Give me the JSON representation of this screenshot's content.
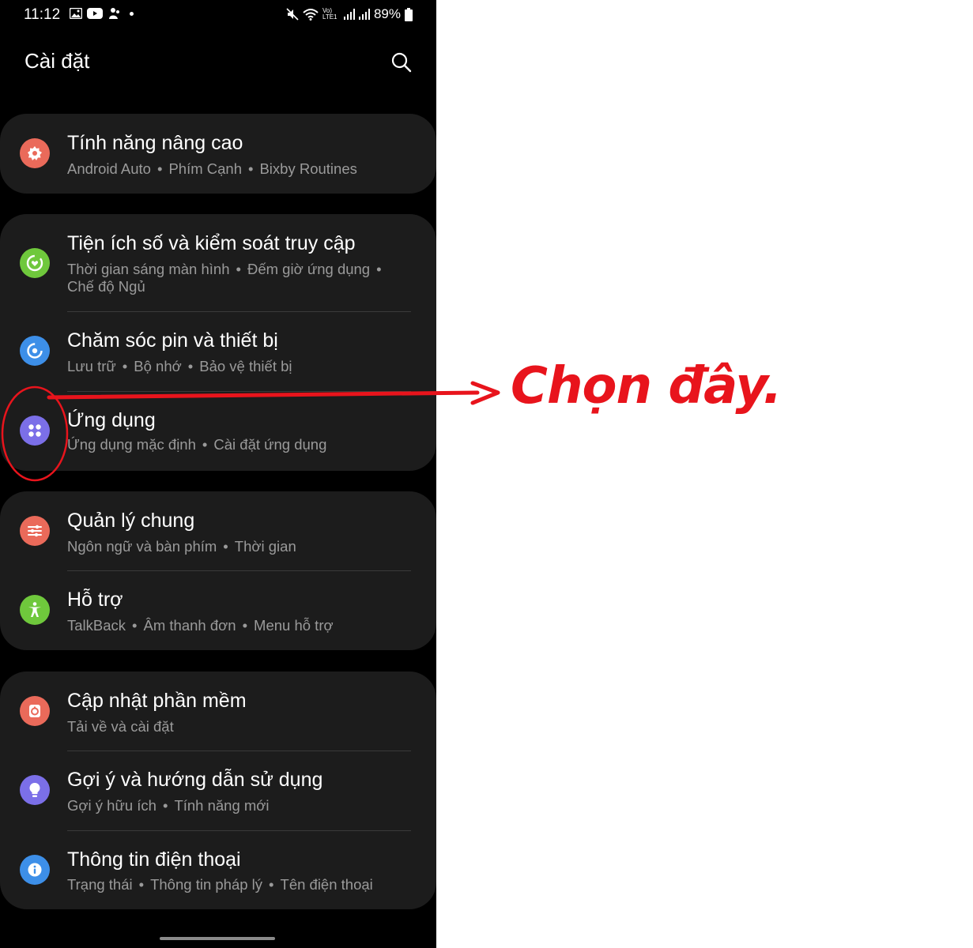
{
  "status_bar": {
    "time": "11:12",
    "network_label": "Vo) LTE1",
    "battery": "89%"
  },
  "app_bar": {
    "title": "Cài đặt",
    "search_icon": "search-icon"
  },
  "groups": [
    {
      "items": [
        {
          "title": "Tính năng nâng cao",
          "subtitle": [
            "Android Auto",
            "Phím Cạnh",
            "Bixby Routines"
          ],
          "icon": "advanced-features-icon",
          "icon_color": "#ea6a5a"
        }
      ]
    },
    {
      "items": [
        {
          "title": "Tiện ích số và kiểm soát truy cập",
          "subtitle": [
            "Thời gian sáng màn hình",
            "Đếm giờ ứng dụng",
            "Chế độ Ngủ"
          ],
          "icon": "digital-wellbeing-icon",
          "icon_color": "#6fc83c"
        },
        {
          "title": "Chăm sóc pin và thiết bị",
          "subtitle": [
            "Lưu trữ",
            "Bộ nhớ",
            "Bảo vệ thiết bị"
          ],
          "icon": "device-care-icon",
          "icon_color": "#3d8fe8"
        },
        {
          "title": "Ứng dụng",
          "subtitle": [
            "Ứng dụng mặc định",
            "Cài đặt ứng dụng"
          ],
          "icon": "apps-icon",
          "icon_color": "#7b6fe8"
        }
      ]
    },
    {
      "items": [
        {
          "title": "Quản lý chung",
          "subtitle": [
            "Ngôn ngữ và bàn phím",
            "Thời gian"
          ],
          "icon": "general-management-icon",
          "icon_color": "#ea6a5a"
        },
        {
          "title": "Hỗ trợ",
          "subtitle": [
            "TalkBack",
            "Âm thanh đơn",
            "Menu hỗ trợ"
          ],
          "icon": "accessibility-icon",
          "icon_color": "#6fc83c"
        }
      ]
    },
    {
      "items": [
        {
          "title": "Cập nhật phần mềm",
          "subtitle": [
            "Tải về và cài đặt"
          ],
          "icon": "software-update-icon",
          "icon_color": "#ea6a5a"
        },
        {
          "title": "Gợi ý và hướng dẫn sử dụng",
          "subtitle": [
            "Gợi ý hữu ích",
            "Tính năng mới"
          ],
          "icon": "tips-icon",
          "icon_color": "#7b6fe8"
        },
        {
          "title": "Thông tin điện thoại",
          "subtitle": [
            "Trạng thái",
            "Thông tin pháp lý",
            "Tên điện thoại"
          ],
          "icon": "about-phone-icon",
          "icon_color": "#3d8fe8"
        }
      ]
    }
  ],
  "annotation": {
    "text": "Chọn đây.",
    "color": "#e8141c"
  }
}
